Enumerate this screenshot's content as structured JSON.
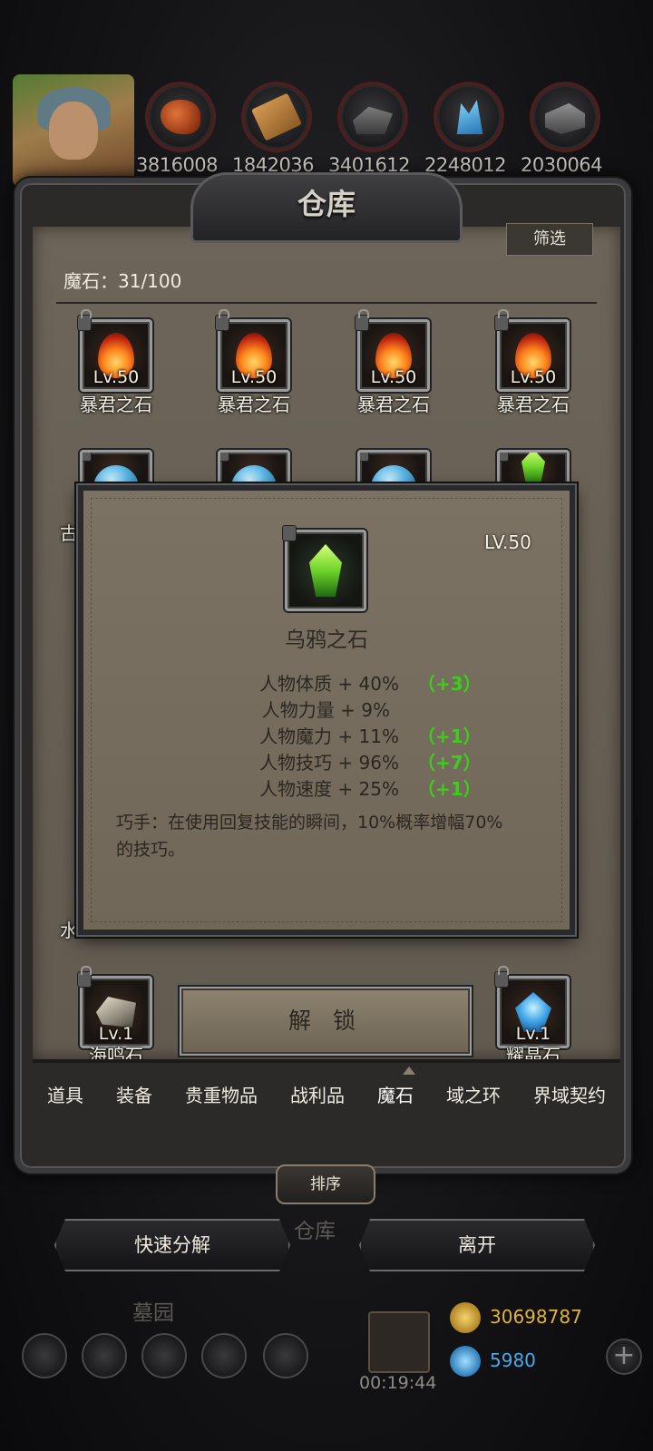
{
  "resources": [
    {
      "icon": "meat-icon",
      "value": "3816008"
    },
    {
      "icon": "wood-icon",
      "value": "1842036"
    },
    {
      "icon": "stone-icon",
      "value": "3401612"
    },
    {
      "icon": "crystal-icon",
      "value": "2248012"
    },
    {
      "icon": "iron-icon",
      "value": "2030064"
    }
  ],
  "panel": {
    "title": "仓库",
    "filter_label": "筛选",
    "count_label": "魔石：31/100"
  },
  "grid_row1": [
    {
      "name": "暴君之石",
      "level": "Lv.50"
    },
    {
      "name": "暴君之石",
      "level": "Lv.50"
    },
    {
      "name": "暴君之石",
      "level": "Lv.50"
    },
    {
      "name": "暴君之石",
      "level": "Lv.50"
    }
  ],
  "grid_row2_partial_name": "古",
  "grid_row3_partial_name": "水",
  "grid_bottom": [
    {
      "name": "海鸣石",
      "level": "Lv.1"
    },
    {
      "name": "耀晶石",
      "level": "Lv.1"
    }
  ],
  "popup": {
    "level": "LV.50",
    "name": "乌鸦之石",
    "stats": [
      {
        "label": "人物体质 + 40%",
        "bonus": "（+3）"
      },
      {
        "label": "人物力量 + 9%",
        "bonus": ""
      },
      {
        "label": "人物魔力 + 11%",
        "bonus": "（+1）"
      },
      {
        "label": "人物技巧 + 96%",
        "bonus": "（+7）"
      },
      {
        "label": "人物速度 + 25%",
        "bonus": "（+1）"
      }
    ],
    "description": "巧手：在使用回复技能的瞬间，10%概率增幅70%的技巧。",
    "unlock_label": "解 锁"
  },
  "tabs": [
    {
      "label": "道具"
    },
    {
      "label": "装备"
    },
    {
      "label": "贵重物品"
    },
    {
      "label": "战利品"
    },
    {
      "label": "魔石",
      "active": true
    },
    {
      "label": "域之环"
    },
    {
      "label": "界域契约"
    }
  ],
  "sort_label": "排序",
  "actions": {
    "quick_decompose": "快速分解",
    "leave": "离开"
  },
  "background_labels": {
    "warehouse": "仓库",
    "graveyard": "墓园"
  },
  "footer": {
    "timer": "00:19:44",
    "gold": "30698787",
    "gems": "5980"
  },
  "colors": {
    "bonus_green": "#39d118",
    "gold_text": "#e0b43a",
    "gem_text": "#4aa8e8"
  }
}
